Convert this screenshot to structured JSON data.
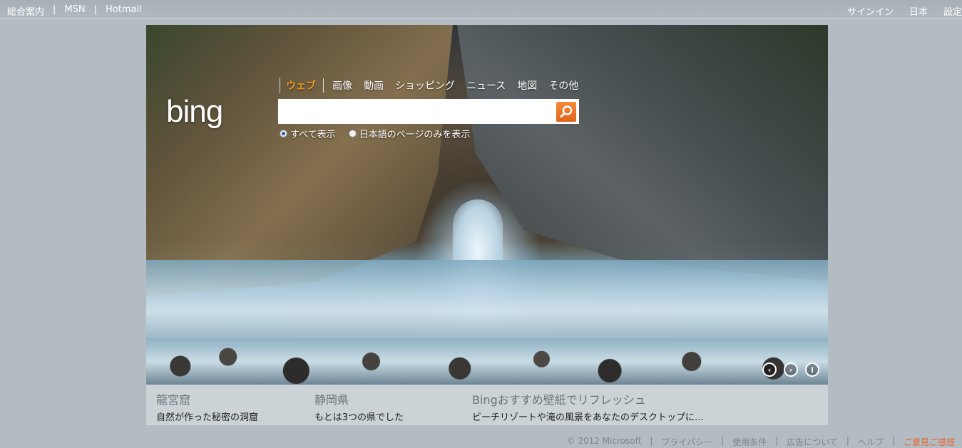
{
  "topbar": {
    "left_links": [
      "総合案内",
      "MSN",
      "Hotmail"
    ],
    "separator": "|",
    "right_links": [
      "サインイン",
      "日本",
      "設定"
    ]
  },
  "logo": {
    "text": "bing"
  },
  "nav": {
    "items": [
      "ウェブ",
      "画像",
      "動画",
      "ショッピング",
      "ニュース",
      "地図",
      "その他"
    ],
    "active_index": 0
  },
  "search": {
    "value": "",
    "placeholder": ""
  },
  "radios": [
    {
      "label": "すべて表示",
      "checked": true
    },
    {
      "label": "日本語のページのみを表示",
      "checked": false
    }
  ],
  "hero_controls": [
    "previous-icon",
    "next-icon",
    "info-icon"
  ],
  "captions": [
    {
      "title": "龍宮窟",
      "subtitle": "自然が作った秘密の洞窟"
    },
    {
      "title": "静岡県",
      "subtitle": "もとは3つの県でした"
    },
    {
      "title": "Bingおすすめ壁紙でリフレッシュ",
      "subtitle": "ビーチリゾートや滝の風景をあなたのデスクトップに…"
    }
  ],
  "footer": {
    "copyright": "© 2012 Microsoft",
    "links": [
      "プライバシー",
      "使用条件",
      "広告について",
      "ヘルプ"
    ],
    "feedback": "ご意見ご感想"
  },
  "colors": {
    "accent": "#f29c1f",
    "search_button": "#e8702a",
    "feedback": "#e8642b"
  }
}
